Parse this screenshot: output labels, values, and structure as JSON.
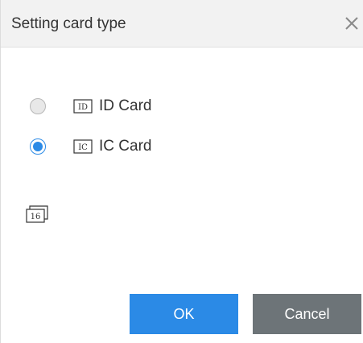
{
  "dialog": {
    "title": "Setting card type",
    "options": [
      {
        "icon_text": "ID",
        "label": "ID Card",
        "checked": false
      },
      {
        "icon_text": "IC",
        "label": "IC Card",
        "checked": true
      }
    ],
    "digit_icon_text": "16",
    "ok_label": "OK",
    "cancel_label": "Cancel"
  },
  "colors": {
    "primary": "#2b8ae6",
    "cancel": "#6d7478",
    "titlebar": "#f2f2f2"
  },
  "icons": {
    "close": "close-icon",
    "id_card": "id-card-icon",
    "ic_card": "ic-card-icon",
    "digits": "card-digits-icon"
  }
}
